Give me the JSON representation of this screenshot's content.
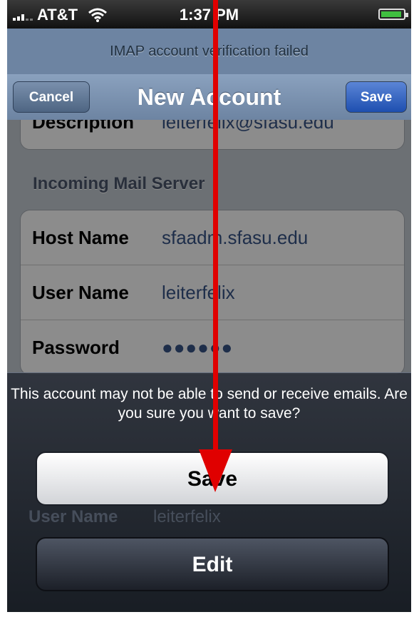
{
  "status_bar": {
    "carrier": "AT&T",
    "time": "1:37 PM"
  },
  "prompt": "IMAP account verification failed",
  "nav": {
    "title": "New Account",
    "cancel_label": "Cancel",
    "save_label": "Save"
  },
  "account": {
    "description_label": "Description",
    "description_value": "leiterfelix@sfasu.edu"
  },
  "incoming": {
    "header": "Incoming Mail Server",
    "rows": [
      {
        "label": "Host Name",
        "value": "sfaadm.sfasu.edu"
      },
      {
        "label": "User Name",
        "value": "leiterfelix"
      },
      {
        "label": "Password",
        "value": "●●●●●●"
      }
    ]
  },
  "behind_sheet": {
    "label": "User Name",
    "value": "leiterfelix"
  },
  "sheet": {
    "message": "This account may not be able to send or receive emails. Are you sure you want to save?",
    "save_label": "Save",
    "edit_label": "Edit"
  },
  "colors": {
    "nav_bar": "#6d84a2",
    "save_button": "#1e4fb0",
    "value_text": "#385487",
    "annotation_arrow": "#e00000"
  },
  "icons": [
    "signal-bars-icon",
    "wifi-icon",
    "battery-icon",
    "annotation-arrow"
  ]
}
